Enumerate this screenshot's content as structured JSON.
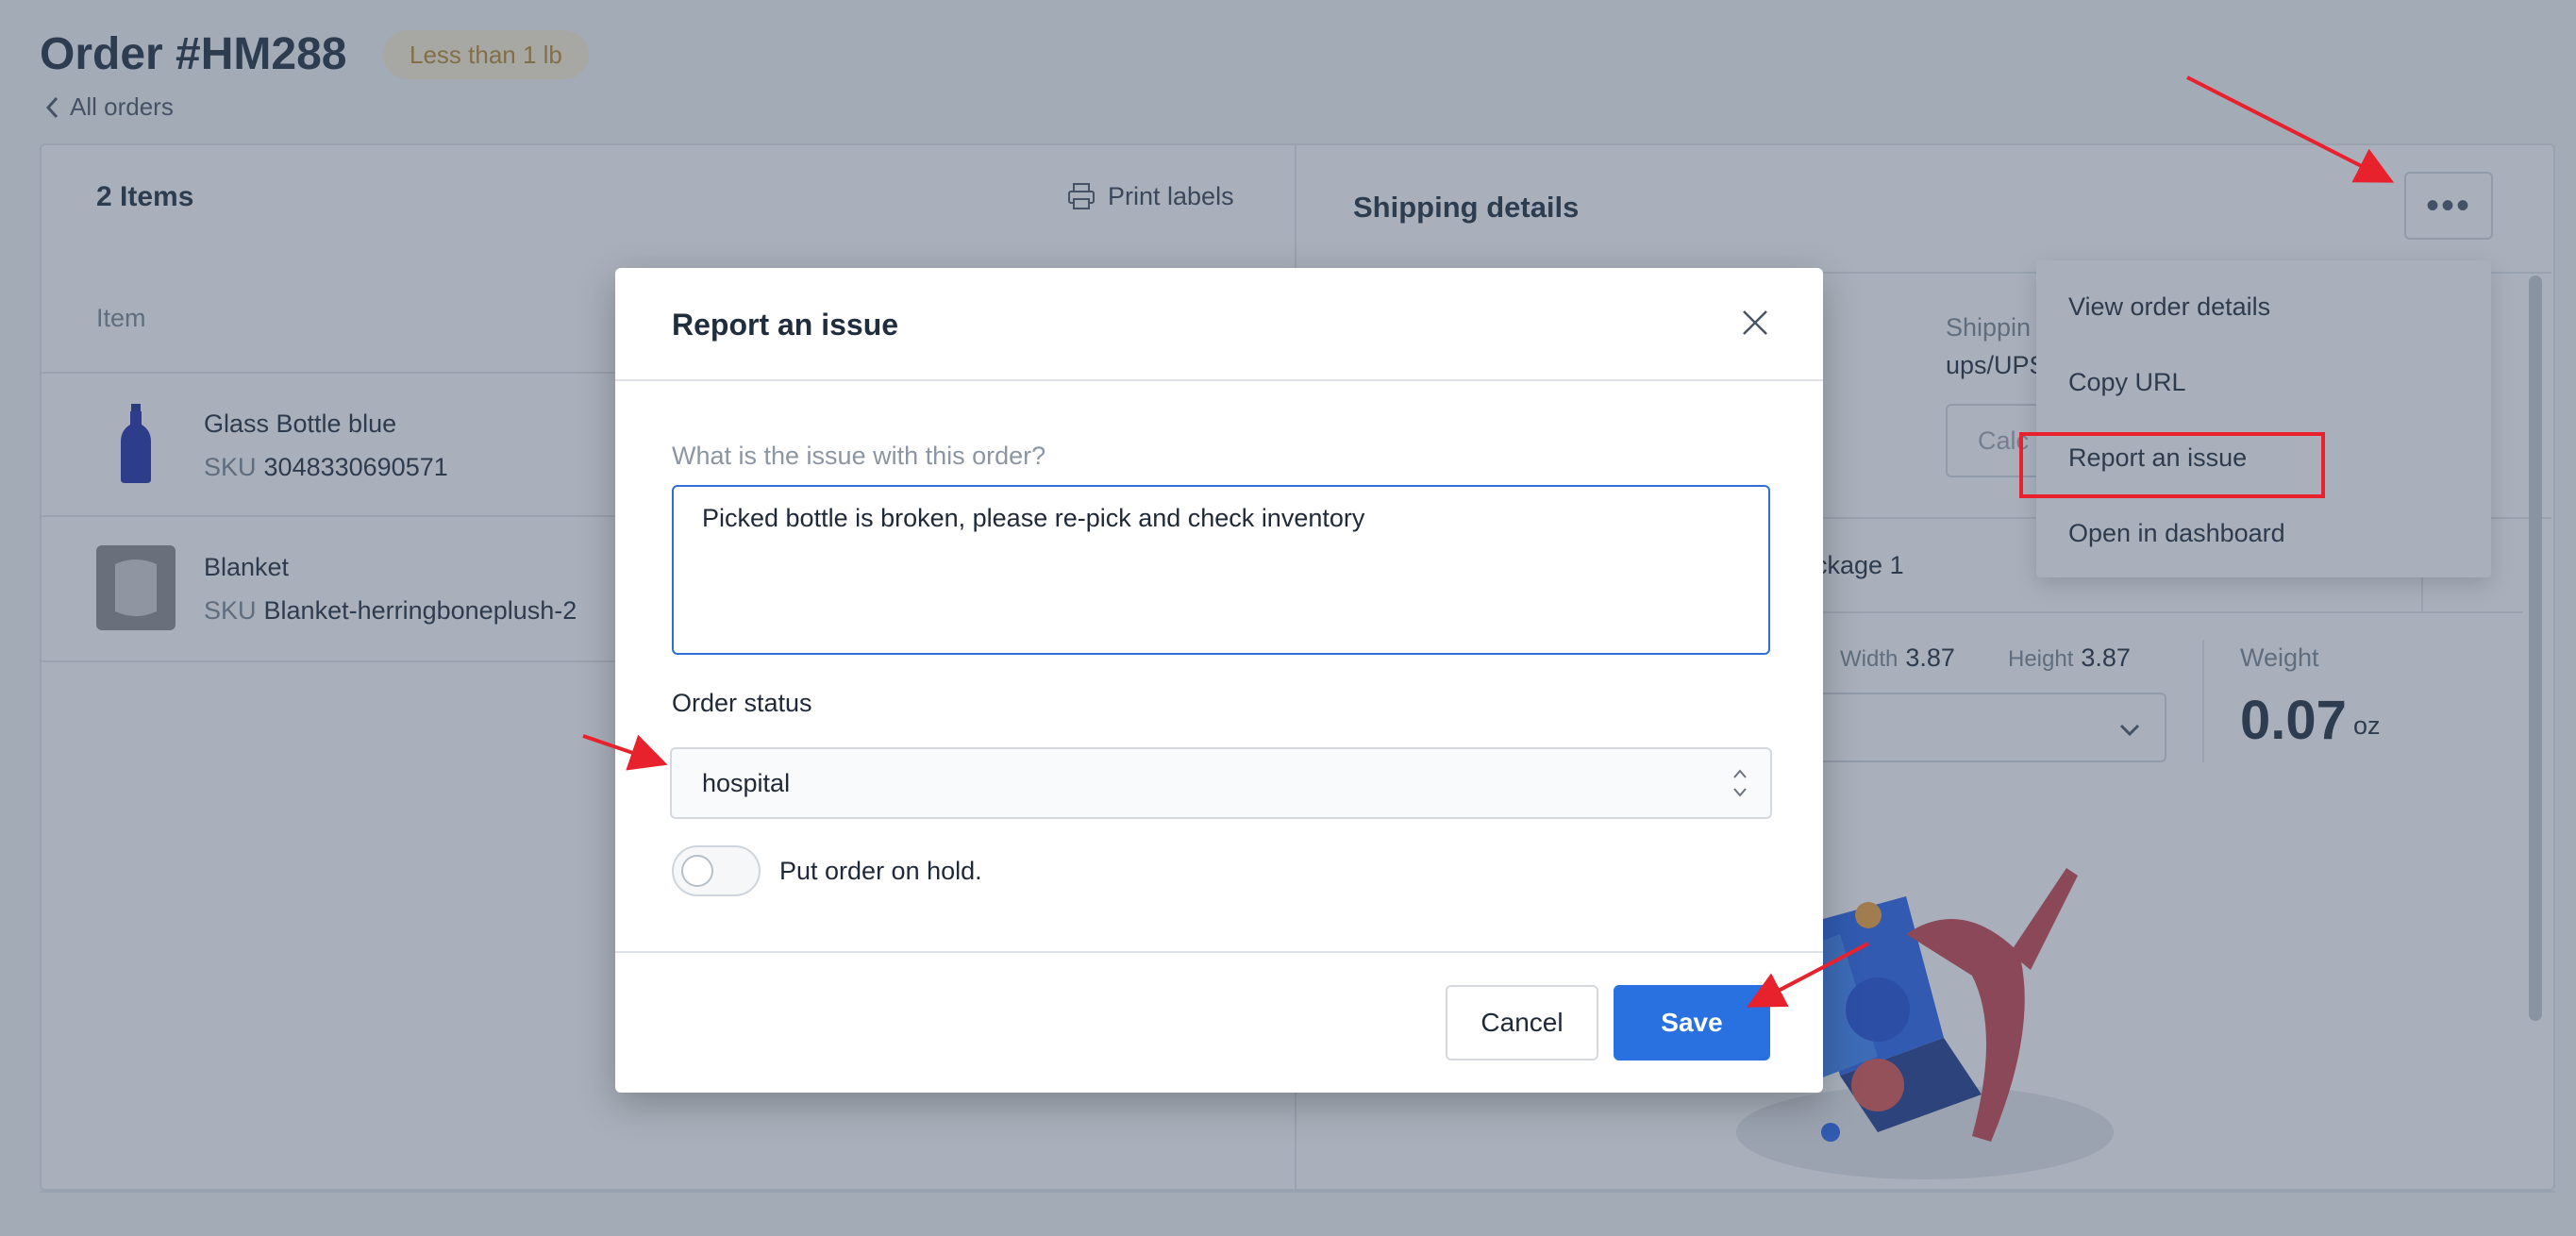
{
  "order": {
    "title": "Order #HM288",
    "weight_badge": "Less than 1 lb",
    "back_link": "All orders"
  },
  "items_panel": {
    "count_label": "2 Items",
    "print_labels": "Print labels",
    "column_item": "Item",
    "items": [
      {
        "name": "Glass Bottle blue",
        "sku_label": "SKU",
        "sku": "3048330690571"
      },
      {
        "name": "Blanket",
        "sku_label": "SKU",
        "sku": "Blanket-herringboneplush-2"
      }
    ]
  },
  "shipping": {
    "title": "Shipping details",
    "more_button": "•••",
    "shipping_label_partial": "Shippin",
    "shipping_value_partial": "ups/UPS",
    "input_partial": "Calc",
    "package_label": "ackage 1",
    "width_label": "Width",
    "width_value": "3.87",
    "height_label": "Height",
    "height_value": "3.87",
    "weight_label": "Weight",
    "weight_value": "0.07",
    "weight_unit": "oz"
  },
  "menu": {
    "items": [
      "View order details",
      "Copy URL",
      "Report an issue",
      "Open in dashboard"
    ]
  },
  "modal": {
    "title": "Report an issue",
    "question": "What is the issue with this order?",
    "issue_text": "Picked bottle is broken, please re-pick and check inventory",
    "status_label": "Order status",
    "status_value": "hospital",
    "hold_label": "Put order on hold.",
    "hold_on": false,
    "cancel": "Cancel",
    "save": "Save"
  },
  "colors": {
    "primary": "#2970e0",
    "annotation": "#e8222c",
    "badge_bg": "#fbf1d6",
    "badge_text": "#b8892c"
  }
}
